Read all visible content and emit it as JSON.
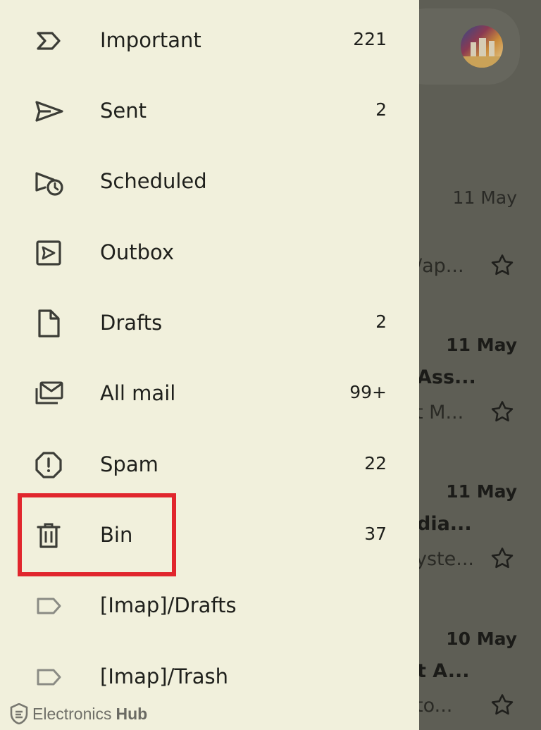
{
  "drawer": {
    "items": [
      {
        "label": "Important",
        "count": "221",
        "icon": "important-icon"
      },
      {
        "label": "Sent",
        "count": "2",
        "icon": "send-icon"
      },
      {
        "label": "Scheduled",
        "count": "",
        "icon": "scheduled-icon"
      },
      {
        "label": "Outbox",
        "count": "",
        "icon": "outbox-icon"
      },
      {
        "label": "Drafts",
        "count": "2",
        "icon": "draft-icon"
      },
      {
        "label": "All mail",
        "count": "99+",
        "icon": "all-mail-icon"
      },
      {
        "label": "Spam",
        "count": "22",
        "icon": "spam-icon"
      },
      {
        "label": "Bin",
        "count": "37",
        "icon": "bin-icon"
      },
      {
        "label": "[Imap]/Drafts",
        "count": "",
        "icon": "label-icon"
      },
      {
        "label": "[Imap]/Trash",
        "count": "",
        "icon": "label-icon"
      }
    ],
    "highlighted_item": "Bin",
    "highlight_color": "#e1262d"
  },
  "inbox_background": {
    "emails": [
      {
        "date": "11 May",
        "sender": "",
        "snippet": "/ap...",
        "unread": false
      },
      {
        "date": "11 May",
        "sender": "Ass...",
        "snippet": "t M...",
        "unread": true
      },
      {
        "date": "11 May",
        "sender": "dia...",
        "snippet": "yste...",
        "unread": true
      },
      {
        "date": "10 May",
        "sender": "t A...",
        "snippet": "to...",
        "unread": true
      }
    ]
  },
  "watermark": {
    "brand_part1": "Electronics",
    "brand_part2": "Hub"
  },
  "colors": {
    "drawer_bg": "#f1f0dc",
    "scrim": "#5e5e55",
    "text": "#1f201c",
    "highlight": "#e1262d"
  }
}
